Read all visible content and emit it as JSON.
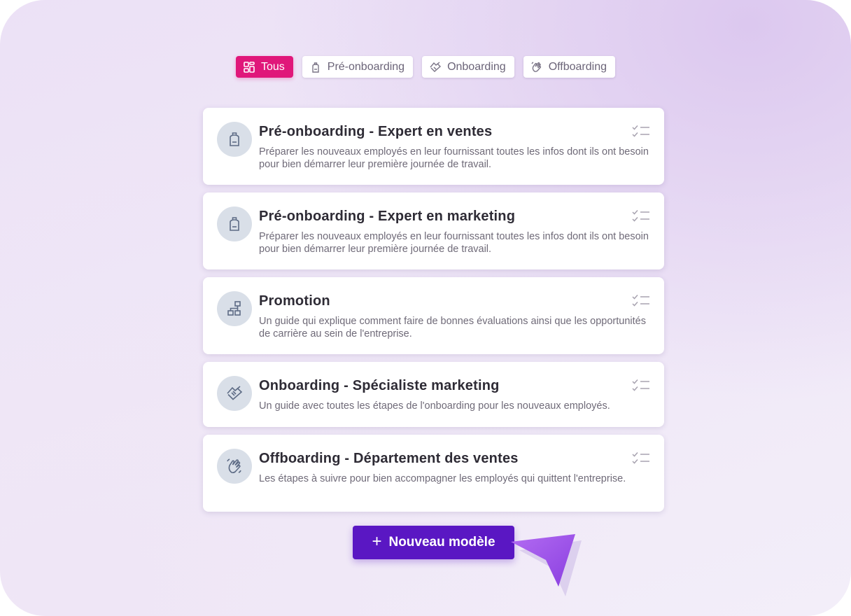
{
  "filters": [
    {
      "label": "Tous",
      "icon": "grid-icon",
      "active": true
    },
    {
      "label": "Pré-onboarding",
      "icon": "backpack-icon",
      "active": false
    },
    {
      "label": "Onboarding",
      "icon": "handshake-icon",
      "active": false
    },
    {
      "label": "Offboarding",
      "icon": "wave-hand-icon",
      "active": false
    }
  ],
  "templates": [
    {
      "title": "Pré-onboarding - Expert en ventes",
      "description": "Préparer les nouveaux employés en leur fournissant toutes les infos dont ils ont besoin pour bien démarrer leur première journée de travail.",
      "icon": "backpack-icon"
    },
    {
      "title": "Pré-onboarding - Expert en marketing",
      "description": "Préparer les nouveaux employés en leur fournissant toutes les infos dont ils ont besoin pour bien démarrer leur première journée de travail.",
      "icon": "backpack-icon"
    },
    {
      "title": "Promotion",
      "description": "Un guide qui explique comment faire de bonnes évaluations ainsi que les opportunités de carrière au sein de l'entreprise.",
      "icon": "org-chart-icon"
    },
    {
      "title": "Onboarding - Spécialiste marketing",
      "description": "Un guide avec toutes les étapes de l'onboarding pour les nouveaux employés.",
      "icon": "handshake-icon"
    },
    {
      "title": "Offboarding - Département des ventes",
      "description": "Les étapes à suivre pour bien accompagner les employés qui quittent l'entreprise.",
      "icon": "wave-hand-icon"
    }
  ],
  "new_button": {
    "label": "Nouveau modèle",
    "icon": "plus-icon"
  },
  "colors": {
    "active_tab": "#e0177a",
    "primary_button": "#5a17c3",
    "cursor": "#9b4fe8",
    "icon_stroke": "#5d6b85"
  }
}
